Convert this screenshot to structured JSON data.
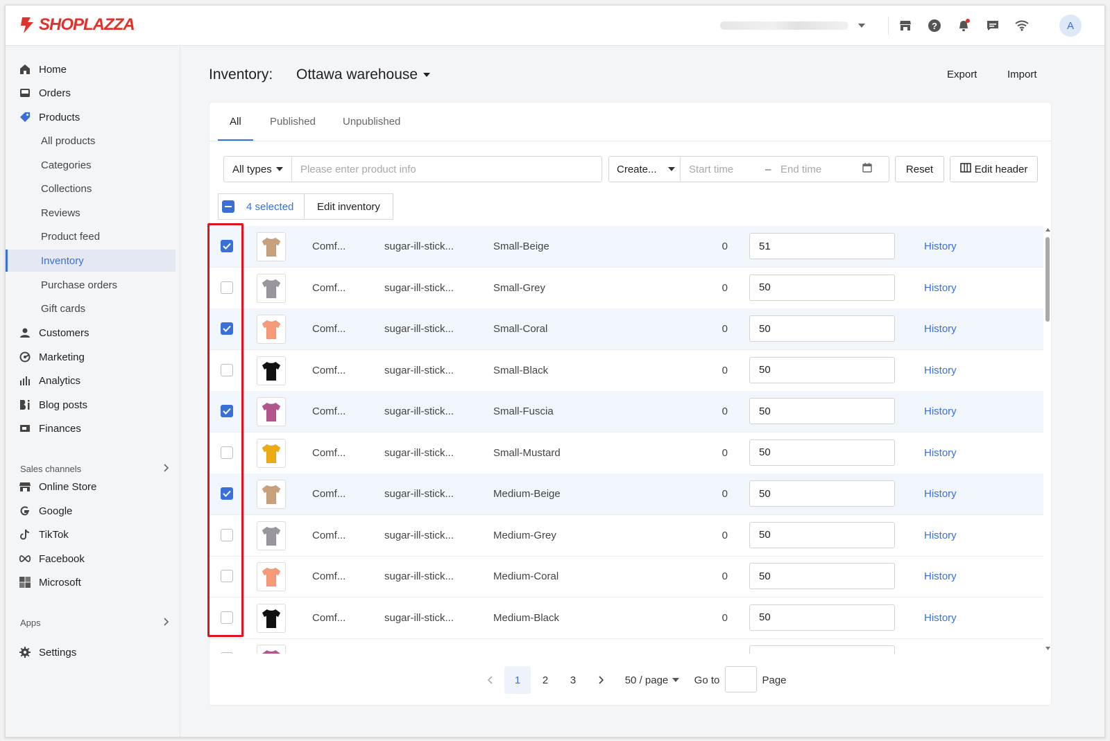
{
  "brand": {
    "name": "SHOPLAZZA",
    "color": "#e0312b"
  },
  "accent": "#3a6fd8",
  "topbar": {
    "icons": [
      "store-icon",
      "help-icon",
      "bell-icon",
      "chat-icon",
      "wifi-icon"
    ],
    "avatar_letter": "A"
  },
  "sidebar": {
    "main": [
      {
        "label": "Home",
        "icon": "home-icon"
      },
      {
        "label": "Orders",
        "icon": "orders-icon"
      },
      {
        "label": "Products",
        "icon": "tag-icon"
      }
    ],
    "products_sub": [
      "All products",
      "Categories",
      "Collections",
      "Reviews",
      "Product feed",
      "Inventory",
      "Purchase orders",
      "Gift cards"
    ],
    "more": [
      {
        "label": "Customers",
        "icon": "person-icon"
      },
      {
        "label": "Marketing",
        "icon": "marketing-icon"
      },
      {
        "label": "Analytics",
        "icon": "analytics-icon"
      },
      {
        "label": "Blog posts",
        "icon": "blog-icon"
      },
      {
        "label": "Finances",
        "icon": "finances-icon"
      }
    ],
    "sales_channels_label": "Sales channels",
    "channels": [
      {
        "label": "Online Store",
        "icon": "store-icon"
      },
      {
        "label": "Google",
        "icon": "google-icon"
      },
      {
        "label": "TikTok",
        "icon": "tiktok-icon"
      },
      {
        "label": "Facebook",
        "icon": "meta-icon"
      },
      {
        "label": "Microsoft",
        "icon": "microsoft-icon"
      }
    ],
    "apps_label": "Apps",
    "settings_label": "Settings"
  },
  "header": {
    "title": "Inventory:",
    "location": "Ottawa warehouse",
    "export_label": "Export",
    "import_label": "Import"
  },
  "tabs": [
    "All",
    "Published",
    "Unpublished"
  ],
  "filters": {
    "type_select": "All types",
    "search_placeholder": "Please enter product info",
    "date_select": "Create...",
    "start_placeholder": "Start time",
    "range_sep": "–",
    "end_placeholder": "End time",
    "reset_label": "Reset",
    "edit_header_label": "Edit header"
  },
  "bulk": {
    "selected_label": "4 selected",
    "edit_label": "Edit inventory"
  },
  "rows": [
    {
      "checked": true,
      "color": "#c9a07c",
      "name": "Comf...",
      "sku": "sugar-ill-stick...",
      "variant": "Small-Beige",
      "committed": "0",
      "qty": "51",
      "history": "History"
    },
    {
      "checked": false,
      "color": "#9a96a0",
      "name": "Comf...",
      "sku": "sugar-ill-stick...",
      "variant": "Small-Grey",
      "committed": "0",
      "qty": "50",
      "history": "History"
    },
    {
      "checked": true,
      "color": "#f59b78",
      "name": "Comf...",
      "sku": "sugar-ill-stick...",
      "variant": "Small-Coral",
      "committed": "0",
      "qty": "50",
      "history": "History"
    },
    {
      "checked": false,
      "color": "#111111",
      "name": "Comf...",
      "sku": "sugar-ill-stick...",
      "variant": "Small-Black",
      "committed": "0",
      "qty": "50",
      "history": "History"
    },
    {
      "checked": true,
      "color": "#b4568e",
      "name": "Comf...",
      "sku": "sugar-ill-stick...",
      "variant": "Small-Fuscia",
      "committed": "0",
      "qty": "50",
      "history": "History"
    },
    {
      "checked": false,
      "color": "#edac12",
      "name": "Comf...",
      "sku": "sugar-ill-stick...",
      "variant": "Small-Mustard",
      "committed": "0",
      "qty": "50",
      "history": "History"
    },
    {
      "checked": true,
      "color": "#c9a07c",
      "name": "Comf...",
      "sku": "sugar-ill-stick...",
      "variant": "Medium-Beige",
      "committed": "0",
      "qty": "50",
      "history": "History"
    },
    {
      "checked": false,
      "color": "#9a96a0",
      "name": "Comf...",
      "sku": "sugar-ill-stick...",
      "variant": "Medium-Grey",
      "committed": "0",
      "qty": "50",
      "history": "History"
    },
    {
      "checked": false,
      "color": "#f59b78",
      "name": "Comf...",
      "sku": "sugar-ill-stick...",
      "variant": "Medium-Coral",
      "committed": "0",
      "qty": "50",
      "history": "History"
    },
    {
      "checked": false,
      "color": "#111111",
      "name": "Comf...",
      "sku": "sugar-ill-stick...",
      "variant": "Medium-Black",
      "committed": "0",
      "qty": "50",
      "history": "History"
    },
    {
      "checked": false,
      "color": "#b4568e",
      "name": "",
      "sku": "",
      "variant": "",
      "committed": "",
      "qty": "",
      "history": ""
    }
  ],
  "pagination": {
    "pages": [
      "1",
      "2",
      "3"
    ],
    "current": "1",
    "page_size": "50 / page",
    "goto_label": "Go to",
    "page_label": "Page"
  }
}
